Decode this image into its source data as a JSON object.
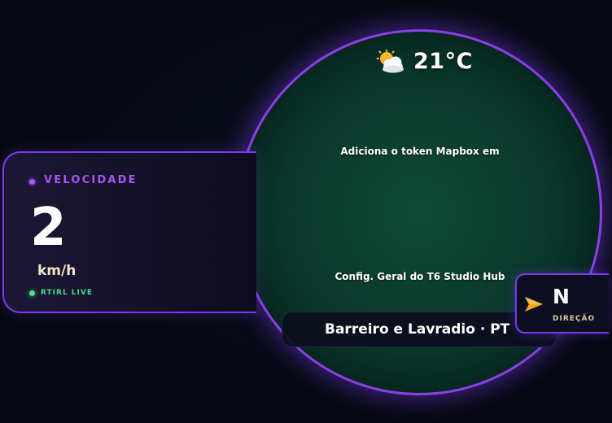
{
  "weather": {
    "icon": "partly-cloudy-icon",
    "temperature": "21°C"
  },
  "map": {
    "message_line1": "Adiciona o token Mapbox em",
    "message_line2": "Config. Geral do T6 Studio Hub"
  },
  "location": {
    "label": "Barreiro e Lavradio · PT"
  },
  "direction": {
    "icon": "navigation-arrow-icon",
    "heading": "N",
    "label": "DIREÇÃO"
  },
  "speed": {
    "title": "VELOCIDADE",
    "value": "2",
    "unit": "km/h",
    "live_label": "RTIRL LIVE"
  },
  "colors": {
    "accent": "#7c3aed",
    "speed_title": "#a855f7",
    "live": "#4ade80",
    "map": "#0b3a2c",
    "arrow": "#f5a623"
  }
}
